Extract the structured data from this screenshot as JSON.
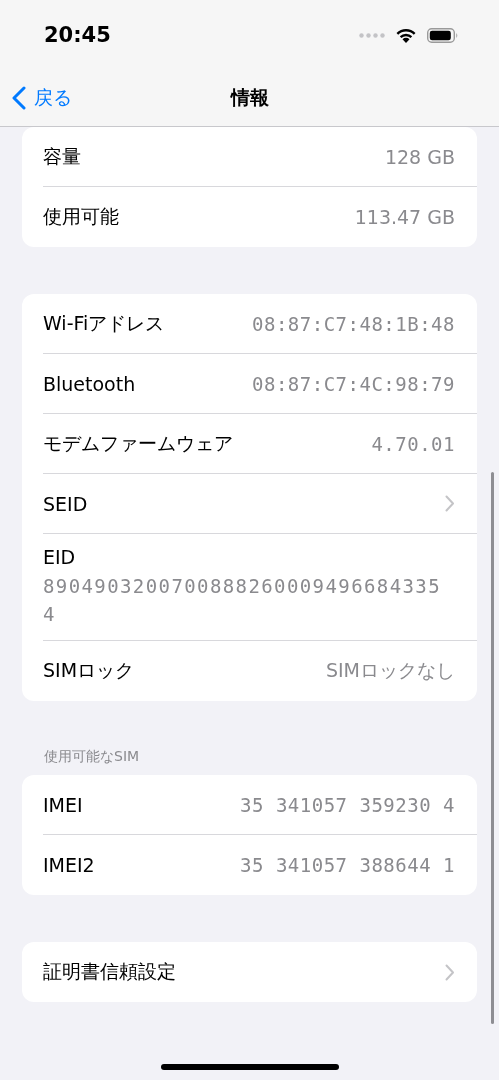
{
  "status_bar": {
    "time": "20:45"
  },
  "nav": {
    "back": "戻る",
    "title": "情報"
  },
  "groups": [
    {
      "rows": [
        {
          "kind": "value",
          "label": "容量",
          "value": "128 GB"
        },
        {
          "kind": "value",
          "label": "使用可能",
          "value": "113.47 GB"
        }
      ]
    },
    {
      "rows": [
        {
          "kind": "mono",
          "label": "Wi-Fiアドレス",
          "value": "08:87:C7:48:1B:48"
        },
        {
          "kind": "mono",
          "label": "Bluetooth",
          "value": "08:87:C7:4C:98:79"
        },
        {
          "kind": "mono",
          "label": "モデムファームウェア",
          "value": "4.70.01"
        },
        {
          "kind": "link",
          "label": "SEID"
        },
        {
          "kind": "stacked",
          "label": "EID",
          "value": "89049032007008882600094966843354"
        },
        {
          "kind": "value",
          "label": "SIMロック",
          "value": "SIMロックなし"
        }
      ]
    },
    {
      "header": "使用可能なSIM",
      "rows": [
        {
          "kind": "mono",
          "label": "IMEI",
          "value": "35 341057 359230 4"
        },
        {
          "kind": "mono",
          "label": "IMEI2",
          "value": "35 341057 388644 1"
        }
      ]
    },
    {
      "rows": [
        {
          "kind": "link",
          "label": "証明書信頼設定"
        }
      ]
    }
  ]
}
